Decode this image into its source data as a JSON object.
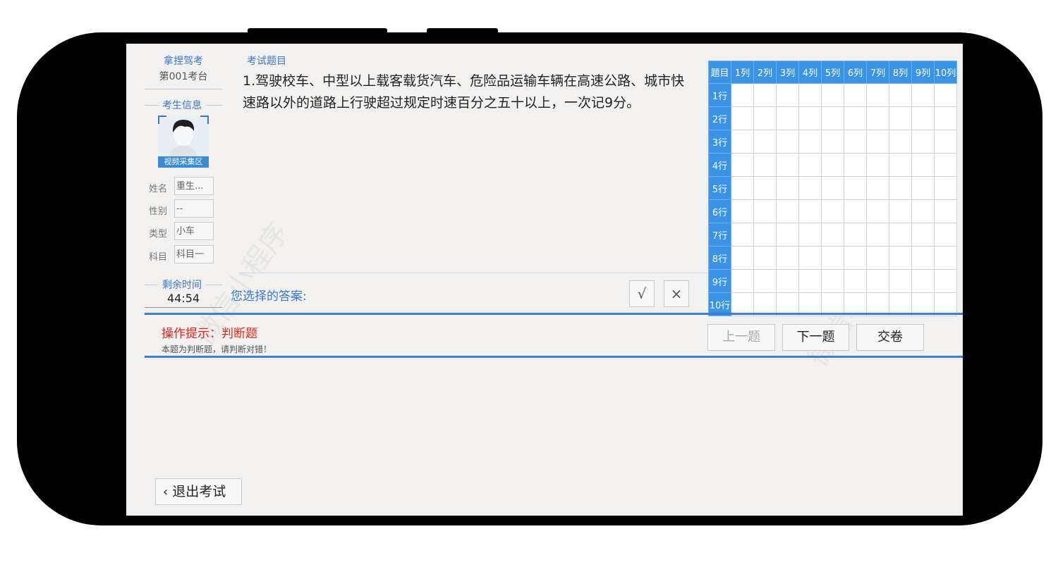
{
  "brand": {
    "name": "拿捏驾考",
    "station": "第001考台"
  },
  "examinee": {
    "section_label": "考生信息",
    "video_caption": "视频采集区",
    "fields": [
      {
        "label": "姓名",
        "value": "重生..."
      },
      {
        "label": "性别",
        "value": "--"
      },
      {
        "label": "类型",
        "value": "小车"
      },
      {
        "label": "科目",
        "value": "科目一"
      }
    ]
  },
  "timer": {
    "label": "剩余时间",
    "value": "44:54"
  },
  "question": {
    "section_label": "考试题目",
    "text": "1.驾驶校车、中型以上载客载货汽车、危险品运输车辆在高速公路、城市快速路以外的道路上行驶超过规定时速百分之五十以上，一次记9分。"
  },
  "answer": {
    "label": "您选择的答案:",
    "options": [
      "√",
      "×"
    ]
  },
  "grid": {
    "corner": "题目",
    "columns": [
      "1列",
      "2列",
      "3列",
      "4列",
      "5列",
      "6列",
      "7列",
      "8列",
      "9列",
      "10列"
    ],
    "rows": [
      "1行",
      "2行",
      "3行",
      "4行",
      "5行",
      "6行",
      "7行",
      "8行",
      "9行",
      "10行"
    ]
  },
  "tip": {
    "title": "操作提示：判断题",
    "text": "本题为判断题，请判断对错！"
  },
  "nav": {
    "prev": "上一题",
    "next": "下一题",
    "submit": "交卷"
  },
  "exit": {
    "label": "退出考试"
  },
  "watermark": "微信小程序",
  "colors": {
    "accent": "#3a93e5",
    "tip": "#e2261a",
    "frame": "#000000"
  }
}
